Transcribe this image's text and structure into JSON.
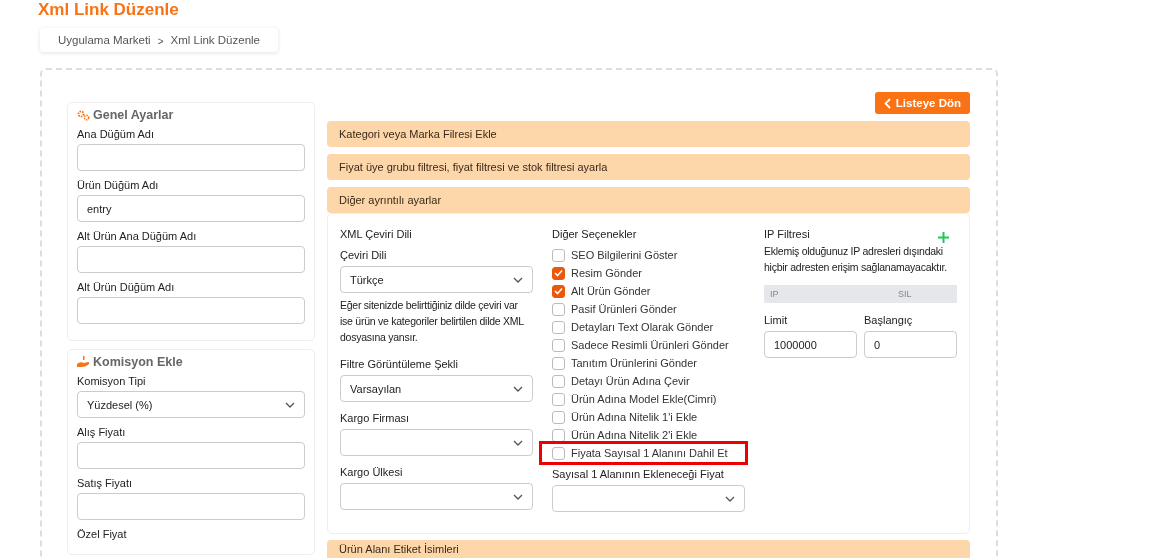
{
  "title": "Xml Link Düzenle",
  "breadcrumb": [
    "Uygulama Marketi",
    "Xml Link Düzenle"
  ],
  "breadcrumb_separator": ">",
  "back_button": "Listeye Dön",
  "cards": [
    {
      "title": "Genel Ayarlar",
      "fields": [
        {
          "label": "Ana Düğüm Adı",
          "kind": "input"
        },
        {
          "label": "Ürün Düğüm Adı",
          "kind": "input",
          "value": "entry"
        },
        {
          "label": "Alt Ürün Ana Düğüm Adı",
          "kind": "input"
        },
        {
          "label": "Alt Ürün Düğüm Adı",
          "kind": "input"
        }
      ]
    },
    {
      "title": "Komisyon Ekle",
      "fields": [
        {
          "label": "Komisyon Tipi",
          "kind": "select",
          "value": "Yüzdesel (%)"
        },
        {
          "label": "Alış Fiyatı",
          "kind": "input"
        },
        {
          "label": "Satış Fiyatı",
          "kind": "input"
        },
        {
          "label": "Özel Fiyat",
          "kind": "label"
        }
      ]
    }
  ],
  "accordions": [
    "Kategori veya Marka Filresi Ekle",
    "Fiyat üye grubu filtresi, fiyat filtresi ve stok filtresi ayarla",
    "Diğer ayrıntılı ayarlar"
  ],
  "translation": {
    "heading": "XML Çeviri Dili",
    "fields": [
      {
        "label": "Çeviri Dili",
        "kind": "select",
        "value": "Türkçe",
        "help": "Eğer sitenizde belirttiğiniz dilde çeviri var ise ürün ve kategoriler belirtilen dilde XML dosyasına yansır."
      },
      {
        "label": "Filtre Görüntüleme Şekli",
        "kind": "select",
        "value": "Varsayılan"
      },
      {
        "label": "Kargo Firması",
        "kind": "select"
      },
      {
        "label": "Kargo Ülkesi",
        "kind": "select"
      }
    ]
  },
  "options": {
    "heading": "Diğer Seçenekler",
    "items": [
      {
        "label": "SEO Bilgilerini Göster",
        "checked": false,
        "highlighted": false
      },
      {
        "label": "Resim Gönder",
        "checked": true,
        "highlighted": false
      },
      {
        "label": "Alt Ürün Gönder",
        "checked": true,
        "highlighted": false
      },
      {
        "label": "Pasif Ürünleri Gönder",
        "checked": false,
        "highlighted": false
      },
      {
        "label": "Detayları Text Olarak Gönder",
        "checked": false,
        "highlighted": false
      },
      {
        "label": "Sadece Resimli Ürünleri Gönder",
        "checked": false,
        "highlighted": false
      },
      {
        "label": "Tanıtım Ürünlerini Gönder",
        "checked": false,
        "highlighted": false
      },
      {
        "label": "Detayı Ürün Adına Çevir",
        "checked": false,
        "highlighted": false
      },
      {
        "label": "Ürün Adına Model Ekle(Cimri)",
        "checked": false,
        "highlighted": false
      },
      {
        "label": "Ürün Adına Nitelik 1'i Ekle",
        "checked": false,
        "highlighted": false
      },
      {
        "label": "Ürün Adına Nitelik 2'i Ekle",
        "checked": false,
        "highlighted": false
      },
      {
        "label": "Fiyata Sayısal 1 Alanını Dahil Et",
        "checked": false,
        "highlighted": true
      }
    ],
    "price_label": "Sayısal 1 Alanının Ekleneceği Fiyat"
  },
  "ip_filter": {
    "heading": "IP Filtresi",
    "description": "Eklemiş olduğunuz IP adresleri dışındaki hiçbir adresten erişim sağlanamayacaktır.",
    "columns": [
      "IP",
      "SIL"
    ],
    "limits": [
      {
        "label": "Limit",
        "value": "1000000"
      },
      {
        "label": "Başlangıç",
        "value": "0"
      }
    ]
  },
  "bottom_accordion": "Ürün Alanı Etiket İsimleri"
}
